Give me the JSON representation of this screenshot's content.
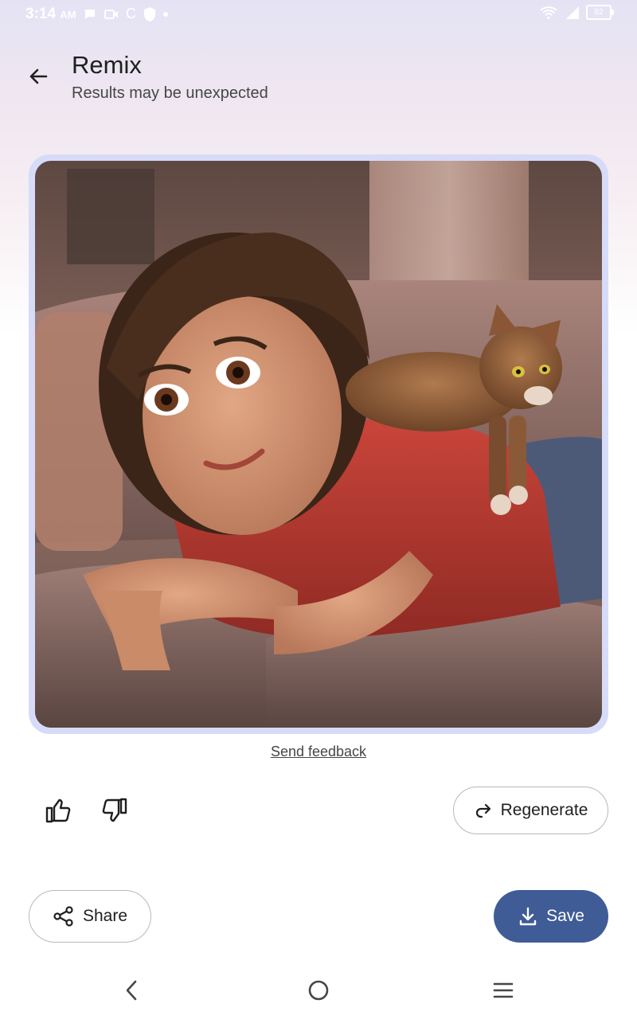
{
  "status_bar": {
    "time": "3:14",
    "ampm": "AM",
    "carrier_letter": "C",
    "battery": "82",
    "icons": [
      "chat-bubble-icon",
      "video-icon",
      "vpn-shield-icon",
      "dot-icon",
      "wifi-icon",
      "signal-icon",
      "battery-icon"
    ]
  },
  "header": {
    "back_icon": "arrow-left-icon",
    "title": "Remix",
    "subtitle": "Results may be unexpected"
  },
  "image": {
    "alt": "Animated-style woman lying on a couch with a cat on her back"
  },
  "feedback": {
    "link_label": "Send feedback"
  },
  "actions": {
    "thumb_up_icon": "thumb-up-icon",
    "thumb_down_icon": "thumb-down-icon",
    "regenerate_label": "Regenerate",
    "share_label": "Share",
    "save_label": "Save"
  },
  "colors": {
    "accent": "#3f5c97",
    "frame": "#d6dcf8"
  },
  "nav": {
    "icons": [
      "nav-back-icon",
      "nav-home-icon",
      "nav-menu-icon"
    ]
  }
}
